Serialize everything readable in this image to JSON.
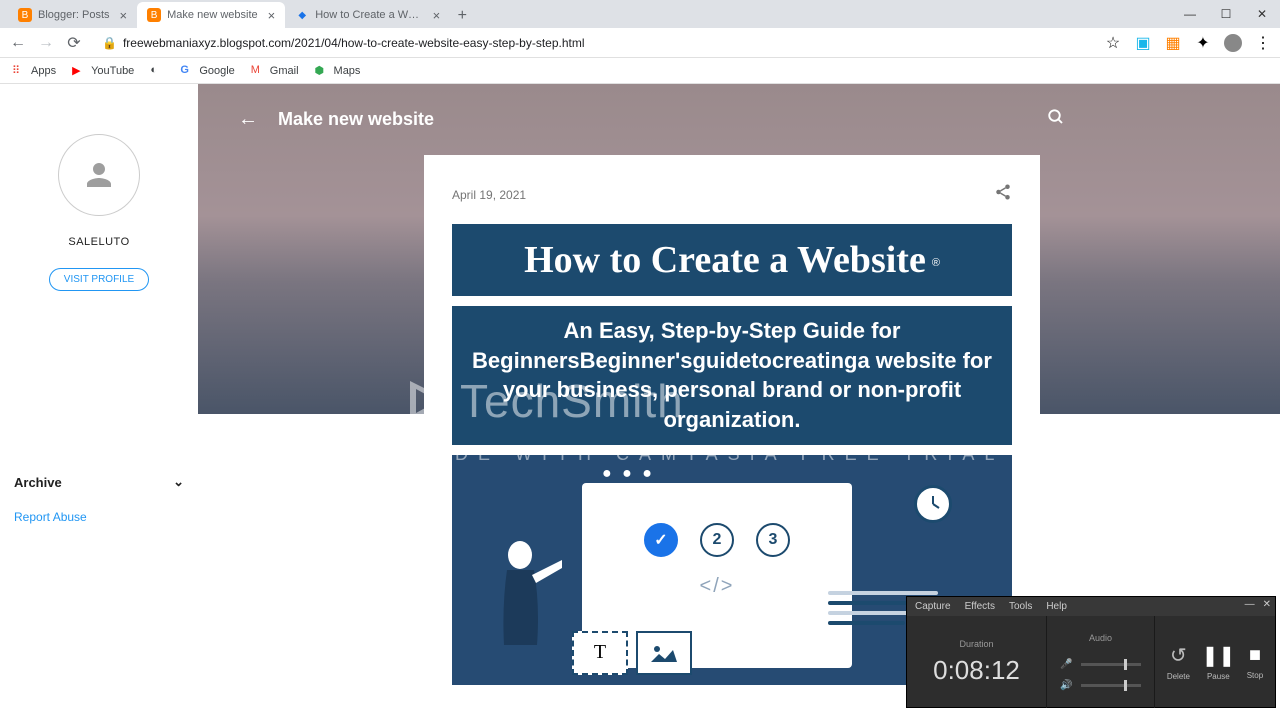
{
  "window": {
    "minimize": "—",
    "maximize": "☐",
    "close": "✕"
  },
  "tabs": [
    {
      "title": "Blogger: Posts",
      "favicon_color": "#ff8000"
    },
    {
      "title": "Make new website",
      "favicon_color": "#ff8000"
    },
    {
      "title": "How to Create a Website: Step-b",
      "favicon_color": "#1a73e8"
    }
  ],
  "address": {
    "url": "freewebmaniaxyz.blogspot.com/2021/04/how-to-create-website-easy-step-by-step.html",
    "lock": "🔒"
  },
  "bookmarks": [
    {
      "label": "Apps",
      "icon": "⠿"
    },
    {
      "label": "YouTube",
      "icon": "▶"
    },
    {
      "label": "",
      "icon": "◐"
    },
    {
      "label": "Google",
      "icon": "G"
    },
    {
      "label": "Gmail",
      "icon": "M"
    },
    {
      "label": "Maps",
      "icon": "⬢"
    }
  ],
  "sidebar": {
    "author": "SALELUTO",
    "visit_profile": "VISIT PROFILE",
    "archive": "Archive",
    "report_abuse": "Report Abuse"
  },
  "blog": {
    "title": "Make new website",
    "post_date": "April 19, 2021",
    "banner_title": "How to Create a Website",
    "banner_r": "®",
    "banner_subtitle": "An Easy, Step-by-Step Guide for BeginnersBeginner'sguidetocreatinga website for your business, personal brand or non-profit organization.",
    "steps": {
      "s2": "2",
      "s3": "3"
    },
    "code_tag": "</>",
    "text_t": "T"
  },
  "watermark": {
    "logo": "TechSmith",
    "text": "MADE WITH CAMTASIA FREE TRIAL"
  },
  "recorder": {
    "menu": {
      "capture": "Capture",
      "effects": "Effects",
      "tools": "Tools",
      "help": "Help"
    },
    "duration_label": "Duration",
    "audio_label": "Audio",
    "time": "0:08:12",
    "delete": "Delete",
    "pause": "Pause",
    "stop": "Stop"
  }
}
